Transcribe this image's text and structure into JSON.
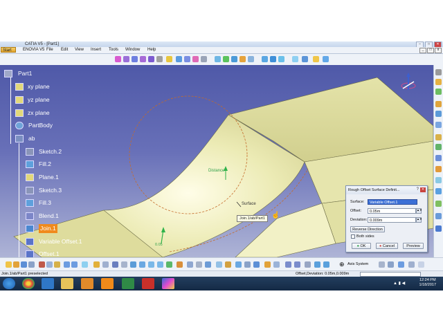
{
  "window": {
    "title": "CATIA V5 - [Part1]",
    "buttons": [
      "–",
      "□",
      "✕"
    ]
  },
  "menubar": {
    "start_label": "Start",
    "items": [
      "ENOVIA V5",
      "File",
      "Edit",
      "View",
      "Insert",
      "Tools",
      "Window",
      "Help"
    ]
  },
  "tree": {
    "items": [
      {
        "label": "Part1",
        "icon": "part-icon"
      },
      {
        "label": "xy plane",
        "icon": "plane-icon"
      },
      {
        "label": "yz plane",
        "icon": "plane-icon"
      },
      {
        "label": "zx plane",
        "icon": "plane-icon"
      },
      {
        "label": "PartBody",
        "icon": "body-gear-icon"
      },
      {
        "label": "ab",
        "icon": "geometrical-set-icon"
      },
      {
        "label": "Sketch.2",
        "icon": "sketch-icon"
      },
      {
        "label": "Fill.2",
        "icon": "fill-icon"
      },
      {
        "label": "Plane.1",
        "icon": "plane-icon"
      },
      {
        "label": "Sketch.3",
        "icon": "sketch-icon"
      },
      {
        "label": "Fill.3",
        "icon": "fill-icon"
      },
      {
        "label": "Blend.1",
        "icon": "blend-icon"
      },
      {
        "label": "Join.1",
        "icon": "join-icon",
        "selected": true
      },
      {
        "label": "Variable Offset.1",
        "icon": "variable-offset-icon"
      },
      {
        "label": "Offset.1",
        "icon": "offset-icon"
      }
    ]
  },
  "viewport": {
    "labels": {
      "distance": "Distance",
      "surface": "Surface",
      "tooltip": "Join.1/ab/Part1",
      "offset_value": "0.05"
    },
    "colors": {
      "background_top": "#4f59a8",
      "surface": "#ecebb5",
      "construction_circle": "#c56b2a",
      "arrow": "#2fb34a"
    }
  },
  "dialog": {
    "title": "Rough Offset Surface Definit...",
    "help": "?",
    "close": "✕",
    "surface_label": "Surface:",
    "surface_value": "Variable Offset.1",
    "offset_label": "Offset:",
    "offset_value": "0.05m",
    "deviation_label": "Deviation:",
    "deviation_value": "0.009m",
    "reverse_label": "Reverse Direction",
    "both_sides_label": "Both sides",
    "both_sides_checked": false,
    "ok_label": "OK",
    "cancel_label": "Cancel",
    "preview_label": "Preview"
  },
  "bottom_toolbar": {
    "axis_system_label": "Axis System"
  },
  "status": {
    "left": "Join.1/ab/Part1 preselected",
    "right": "Offset,Deviation: 0.05m,0.009m"
  },
  "taskbar": {
    "time": "12:24 PM",
    "date": "1/18/2017",
    "apps": [
      "windows-start-icon",
      "chrome-icon",
      "internet-explorer-icon",
      "file-explorer-icon",
      "media-player-icon",
      "vlc-icon",
      "excel-icon",
      "solidworks-icon",
      "catia-icon"
    ]
  }
}
